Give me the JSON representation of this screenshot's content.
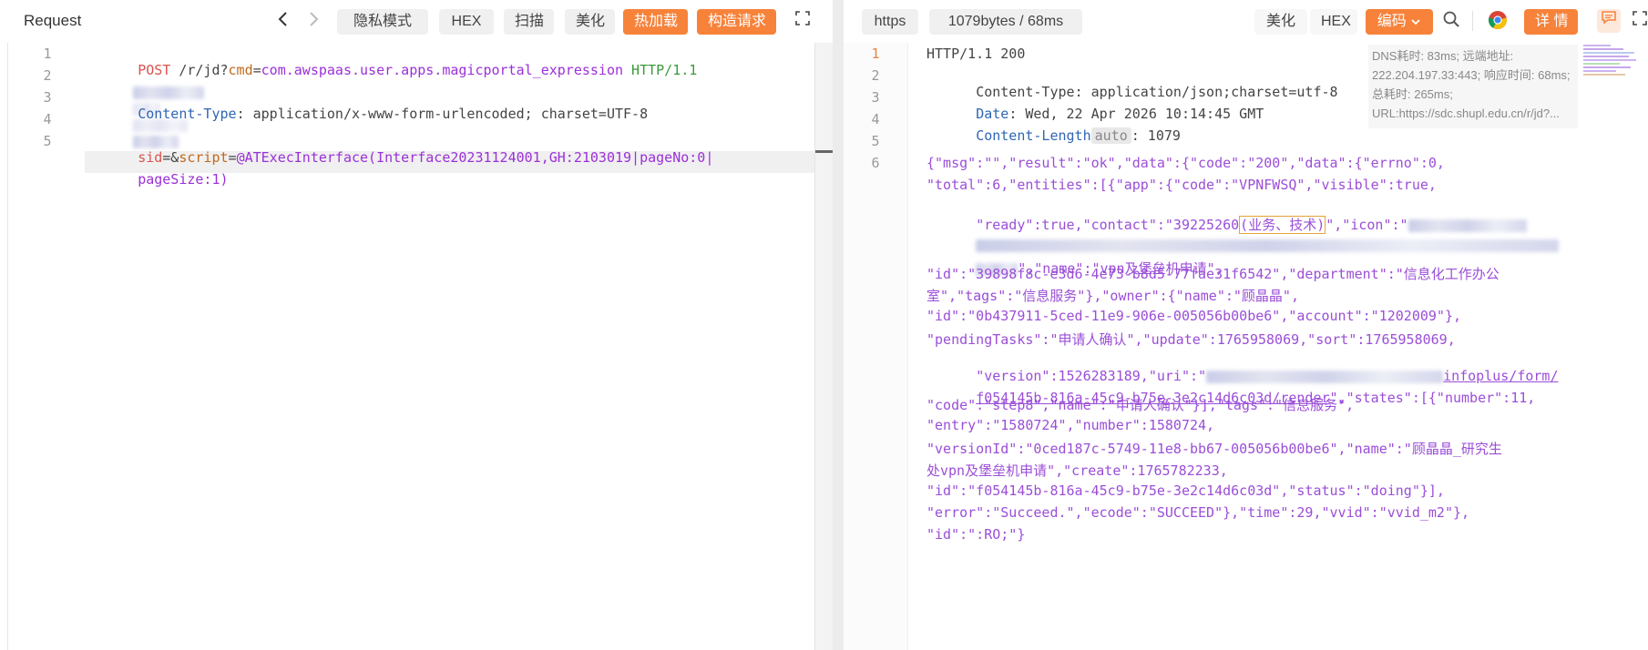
{
  "left": {
    "title": "Request",
    "buttons": {
      "privacy": "隐私模式",
      "hex": "HEX",
      "scan": "扫描",
      "beautify": "美化",
      "hot_load": "热加载",
      "build_request": "构造请求"
    },
    "lines": {
      "l1": {
        "no": "1",
        "method": "POST",
        "path": " /r/jd?",
        "param_key": "cmd",
        "eq": "=",
        "param_val": "com.awspaas.user.apps.magicportal_expression",
        "version": " HTTP/1.1"
      },
      "l2": {
        "no": "2"
      },
      "l3": {
        "no": "3",
        "key": "Content-Type",
        "colon": ":",
        "value": " application/x-www-form-urlencoded; charset=UTF-8"
      },
      "l4": {
        "no": "4"
      },
      "l5": {
        "no": "5",
        "k1": "sid",
        "eq1": "=&",
        "k2": "script",
        "eq2": "=",
        "v2": "@ATExecInterface(Interface20231124001,GH:2103019|pageNo:0|",
        "v2b": "pageSize:1)"
      }
    }
  },
  "right": {
    "protocol": "https",
    "stats": "1079bytes / 68ms",
    "buttons": {
      "beautify": "美化",
      "hex": "HEX",
      "encoding": "编码",
      "details": "详 情"
    },
    "info": "DNS耗时: 83ms; 远端地址: 222.204.197.33:443; 响应时间: 68ms; 总耗时: 265ms; URL:https://sdc.shupl.edu.cn/r/jd?...",
    "headers": {
      "l1": {
        "no": "1",
        "text": "HTTP/1.1 200"
      },
      "l2": {
        "no": "2",
        "key": "Content-Type",
        "value": ": application/json;charset=utf-8"
      },
      "l3": {
        "no": "3",
        "key": "Date",
        "value": ": Wed, 22 Apr 2026 10:14:45 GMT"
      },
      "l4": {
        "no": "4",
        "key": "Content-Length",
        "auto": "auto",
        "value": ": 1079"
      },
      "l5": {
        "no": "5"
      },
      "l6": {
        "no": "6"
      }
    },
    "body": {
      "r1a": "{\"msg\":\"\",\"result\":\"ok\",\"data\":{\"code\":\"200\",\"data\":{\"errno\":0,",
      "r2a": "\"total\":6,\"entities\":[{\"app\":{\"code\":\"VPNFWSQ\",\"visible\":true,",
      "r3a": "\"ready\":true,\"contact\":\"39225260",
      "r3b": "(业务、技术)",
      "r3c": "\",\"icon\":\"",
      "r5b": "\",\"name\":\"vpn及堡垒机申请\",",
      "r6": "\"id\":\"39898f8c-e3d6-4e73-b8d5-77fae31f6542\",\"department\":\"信息化工作办公",
      "r7": "室\",\"tags\":\"信息服务\"},\"owner\":{\"name\":\"顾晶晶\",",
      "r8": "\"id\":\"0b437911-5ced-11e9-906e-005056b00be6\",\"account\":\"1202009\"},",
      "r9": "\"pendingTasks\":\"申请人确认\",\"update\":1765958069,\"sort\":1765958069,",
      "r10a": "\"version\":1526283189,\"uri\":\"",
      "r10b": "infoplus/form/",
      "r11a": "f054145b-816a-45c9-b75e-3e2c14d6c03d/render",
      "r11b": "\",\"states\":[{\"number\":11,",
      "r12": "\"code\":\"step8\",\"name\":\"申请人确认\"}],\"tags\":\"信息服务\",",
      "r13": "\"entry\":\"1580724\",\"number\":1580724,",
      "r14": "\"versionId\":\"0ced187c-5749-11e8-bb67-005056b00be6\",\"name\":\"顾晶晶_研究生",
      "r15": "处vpn及堡垒机申请\",\"create\":1765782233,",
      "r16": "\"id\":\"f054145b-816a-45c9-b75e-3e2c14d6c03d\",\"status\":\"doing\"}],",
      "r17": "\"error\":\"Succeed.\",\"ecode\":\"SUCCEED\"},\"time\":29,\"vvid\":\"vvid_m2\"},",
      "r18": "\"id\":\":RO;\"}"
    }
  },
  "icons": {
    "back": "chevron-left-icon",
    "forward": "chevron-right-icon",
    "fullscreen": "fullscreen-icon",
    "search": "search-icon",
    "chrome": "chrome-icon",
    "comment": "comment-icon"
  },
  "colors": {
    "accent": "#f7823a",
    "method": "#d9534f",
    "param_key": "#c26a1d",
    "param_value": "#9b30d9",
    "http_version": "#3a9a3a",
    "header_key": "#2f66b3"
  }
}
